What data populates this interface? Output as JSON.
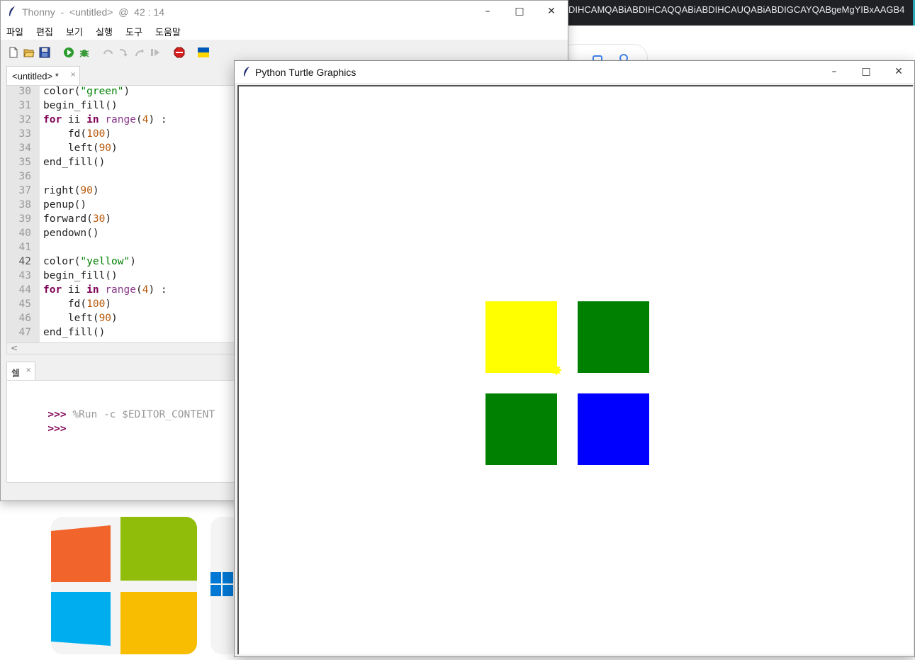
{
  "background": {
    "browser_url_fragment": "DIHCAMQABiABDIHCAQQABiABDIHCAUQABiABDIGCAYQABgeMgYIBxAAGB4"
  },
  "thonny": {
    "title": "Thonny  -  <untitled>  @  42 : 14",
    "window_controls": {
      "minimize": "–",
      "maximize": "□",
      "close": "✕"
    },
    "menu": [
      "파일",
      "편집",
      "보기",
      "실행",
      "도구",
      "도움말"
    ],
    "toolbar_icons": [
      "new-file-icon",
      "open-file-icon",
      "save-icon",
      "run-icon",
      "debug-icon",
      "step-over-icon",
      "step-into-icon",
      "step-out-icon",
      "resume-icon",
      "stop-icon",
      "ukraine-flag-icon"
    ],
    "editor_tab": {
      "label": "<untitled> *",
      "close": "×"
    },
    "code": [
      {
        "ln": "30",
        "tokens": [
          [
            "t",
            "color("
          ],
          [
            "s",
            "\"green\""
          ],
          [
            "t",
            ")"
          ]
        ]
      },
      {
        "ln": "31",
        "tokens": [
          [
            "t",
            "begin_fill()"
          ]
        ]
      },
      {
        "ln": "32",
        "tokens": [
          [
            "k",
            "for"
          ],
          [
            "t",
            " ii "
          ],
          [
            "k",
            "in"
          ],
          [
            "t",
            " "
          ],
          [
            "b",
            "range"
          ],
          [
            "t",
            "("
          ],
          [
            "n",
            "4"
          ],
          [
            "t",
            ") :"
          ]
        ]
      },
      {
        "ln": "33",
        "tokens": [
          [
            "t",
            "    fd("
          ],
          [
            "n",
            "100"
          ],
          [
            "t",
            ")"
          ]
        ]
      },
      {
        "ln": "34",
        "tokens": [
          [
            "t",
            "    left("
          ],
          [
            "n",
            "90"
          ],
          [
            "t",
            ")"
          ]
        ]
      },
      {
        "ln": "35",
        "tokens": [
          [
            "t",
            "end_fill()"
          ]
        ]
      },
      {
        "ln": "36",
        "tokens": []
      },
      {
        "ln": "37",
        "tokens": [
          [
            "t",
            "right("
          ],
          [
            "n",
            "90"
          ],
          [
            "t",
            ")"
          ]
        ]
      },
      {
        "ln": "38",
        "tokens": [
          [
            "t",
            "penup()"
          ]
        ]
      },
      {
        "ln": "39",
        "tokens": [
          [
            "t",
            "forward("
          ],
          [
            "n",
            "30"
          ],
          [
            "t",
            ")"
          ]
        ]
      },
      {
        "ln": "40",
        "tokens": [
          [
            "t",
            "pendown()"
          ]
        ]
      },
      {
        "ln": "41",
        "tokens": []
      },
      {
        "ln": "42",
        "tokens": [
          [
            "t",
            "color("
          ],
          [
            "s",
            "\"yellow\""
          ],
          [
            "t",
            ")"
          ]
        ]
      },
      {
        "ln": "43",
        "tokens": [
          [
            "t",
            "begin_fill()"
          ]
        ]
      },
      {
        "ln": "44",
        "tokens": [
          [
            "k",
            "for"
          ],
          [
            "t",
            " ii "
          ],
          [
            "k",
            "in"
          ],
          [
            "t",
            " "
          ],
          [
            "b",
            "range"
          ],
          [
            "t",
            "("
          ],
          [
            "n",
            "4"
          ],
          [
            "t",
            ") :"
          ]
        ]
      },
      {
        "ln": "45",
        "tokens": [
          [
            "t",
            "    fd("
          ],
          [
            "n",
            "100"
          ],
          [
            "t",
            ")"
          ]
        ]
      },
      {
        "ln": "46",
        "tokens": [
          [
            "t",
            "    left("
          ],
          [
            "n",
            "90"
          ],
          [
            "t",
            ")"
          ]
        ]
      },
      {
        "ln": "47",
        "tokens": [
          [
            "t",
            "end_fill()"
          ]
        ]
      }
    ],
    "current_line": "42",
    "scroll_left_arrow": "<",
    "shell_tab": {
      "label": "쉘",
      "close": "×"
    },
    "shell_lines": [
      {
        "prompt": ">>>",
        "command": " %Run -c $EDITOR_CONTENT"
      },
      {
        "prompt": ">>>",
        "command": ""
      }
    ]
  },
  "turtle_window": {
    "title": "Python Turtle Graphics",
    "window_controls": {
      "minimize": "–",
      "maximize": "□",
      "close": "✕"
    },
    "squares": [
      {
        "name": "yellow-square",
        "color": "#ffff00"
      },
      {
        "name": "green-square-top-right",
        "color": "#008000"
      },
      {
        "name": "green-square-bottom-left",
        "color": "#008000"
      },
      {
        "name": "blue-square",
        "color": "#0000ff"
      }
    ],
    "turtle_color": "#ffff00"
  }
}
